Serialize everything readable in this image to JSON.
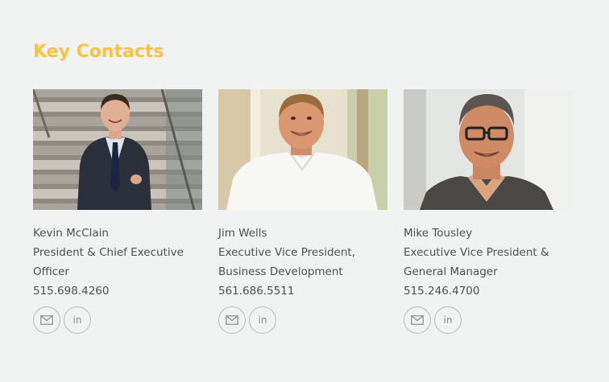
{
  "section_title": "Key Contacts",
  "contacts": [
    {
      "name": "Kevin McClain",
      "title": "President & Chief Executive Officer",
      "phone": "515.698.4260",
      "email_icon": "envelope-icon",
      "linkedin_icon": "linkedin-icon",
      "linkedin_text": "in"
    },
    {
      "name": "Jim Wells",
      "title": "Executive Vice President, Business Development",
      "phone": "561.686.5511",
      "email_icon": "envelope-icon",
      "linkedin_icon": "linkedin-icon",
      "linkedin_text": "in"
    },
    {
      "name": "Mike Tousley",
      "title": "Executive Vice President & General Manager",
      "phone": "515.246.4700",
      "email_icon": "envelope-icon",
      "linkedin_icon": "linkedin-icon",
      "linkedin_text": "in"
    }
  ],
  "colors": {
    "accent": "#fcc23f",
    "background": "#f1f2f2",
    "text": "#4f4f4f",
    "icon_border": "#b9b9b9"
  }
}
